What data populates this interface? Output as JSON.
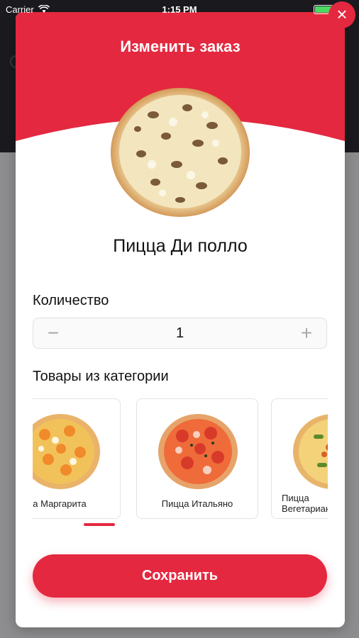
{
  "status_bar": {
    "carrier": "Carrier",
    "time": "1:15 PM"
  },
  "modal": {
    "title": "Изменить заказ",
    "product_name": "Пицца Ди полло",
    "accent_color": "#e4283f"
  },
  "quantity": {
    "label": "Количество",
    "value": "1",
    "minus": "−",
    "plus": "+"
  },
  "category": {
    "label": "Товары из категории",
    "items": [
      {
        "name": "а Маргарита"
      },
      {
        "name": "Пицца Итальяно"
      },
      {
        "name_line1": "Пицца",
        "name_line2": "Вегетарианск"
      }
    ]
  },
  "save_button": {
    "label": "Сохранить"
  },
  "close_button": {
    "label": "×"
  }
}
